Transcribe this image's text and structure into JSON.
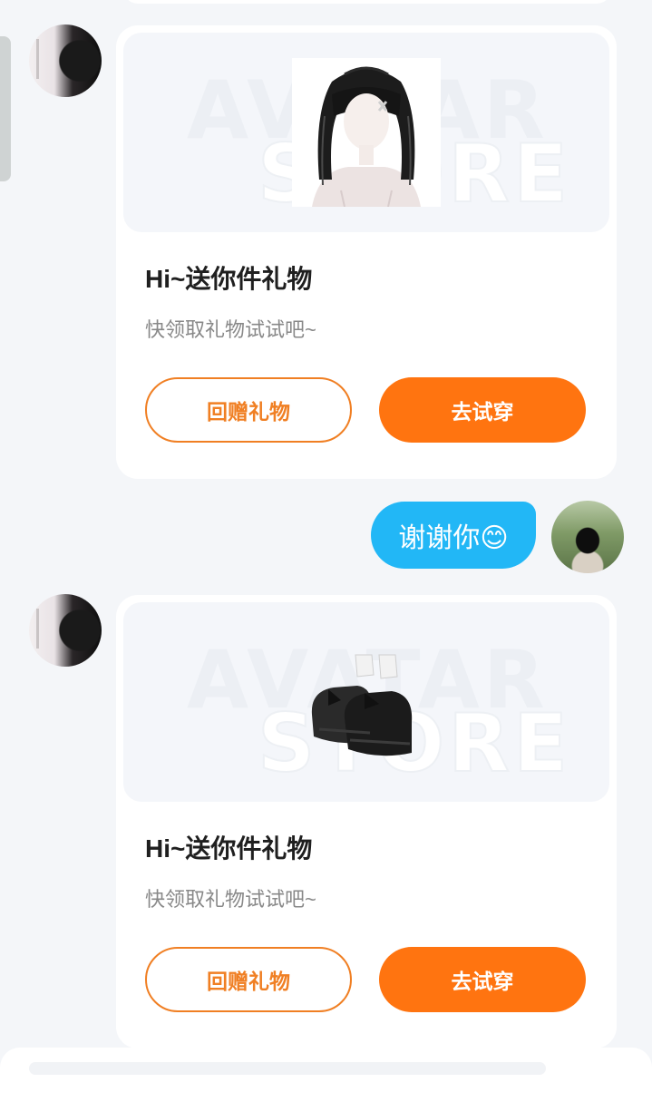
{
  "messages": [
    {
      "title": "Hi~送你件礼物",
      "subtitle": "快领取礼物试试吧~",
      "watermark_line1": "AVATAR",
      "watermark_line2": "STORE",
      "item_icon": "hair-icon",
      "return_gift_label": "回赠礼物",
      "try_on_label": "去试穿"
    },
    {
      "title": "Hi~送你件礼物",
      "subtitle": "快领取礼物试试吧~",
      "watermark_line1": "AVATAR",
      "watermark_line2": "STORE",
      "item_icon": "shoes-icon",
      "return_gift_label": "回赠礼物",
      "try_on_label": "去试穿"
    }
  ],
  "my_reply": "谢谢你😊",
  "colors": {
    "page_background": "#f4f6f9",
    "try_on_button": "#ff7410",
    "return_gift_button_border": "#f07f23",
    "my_bubble": "#22b7f6"
  }
}
